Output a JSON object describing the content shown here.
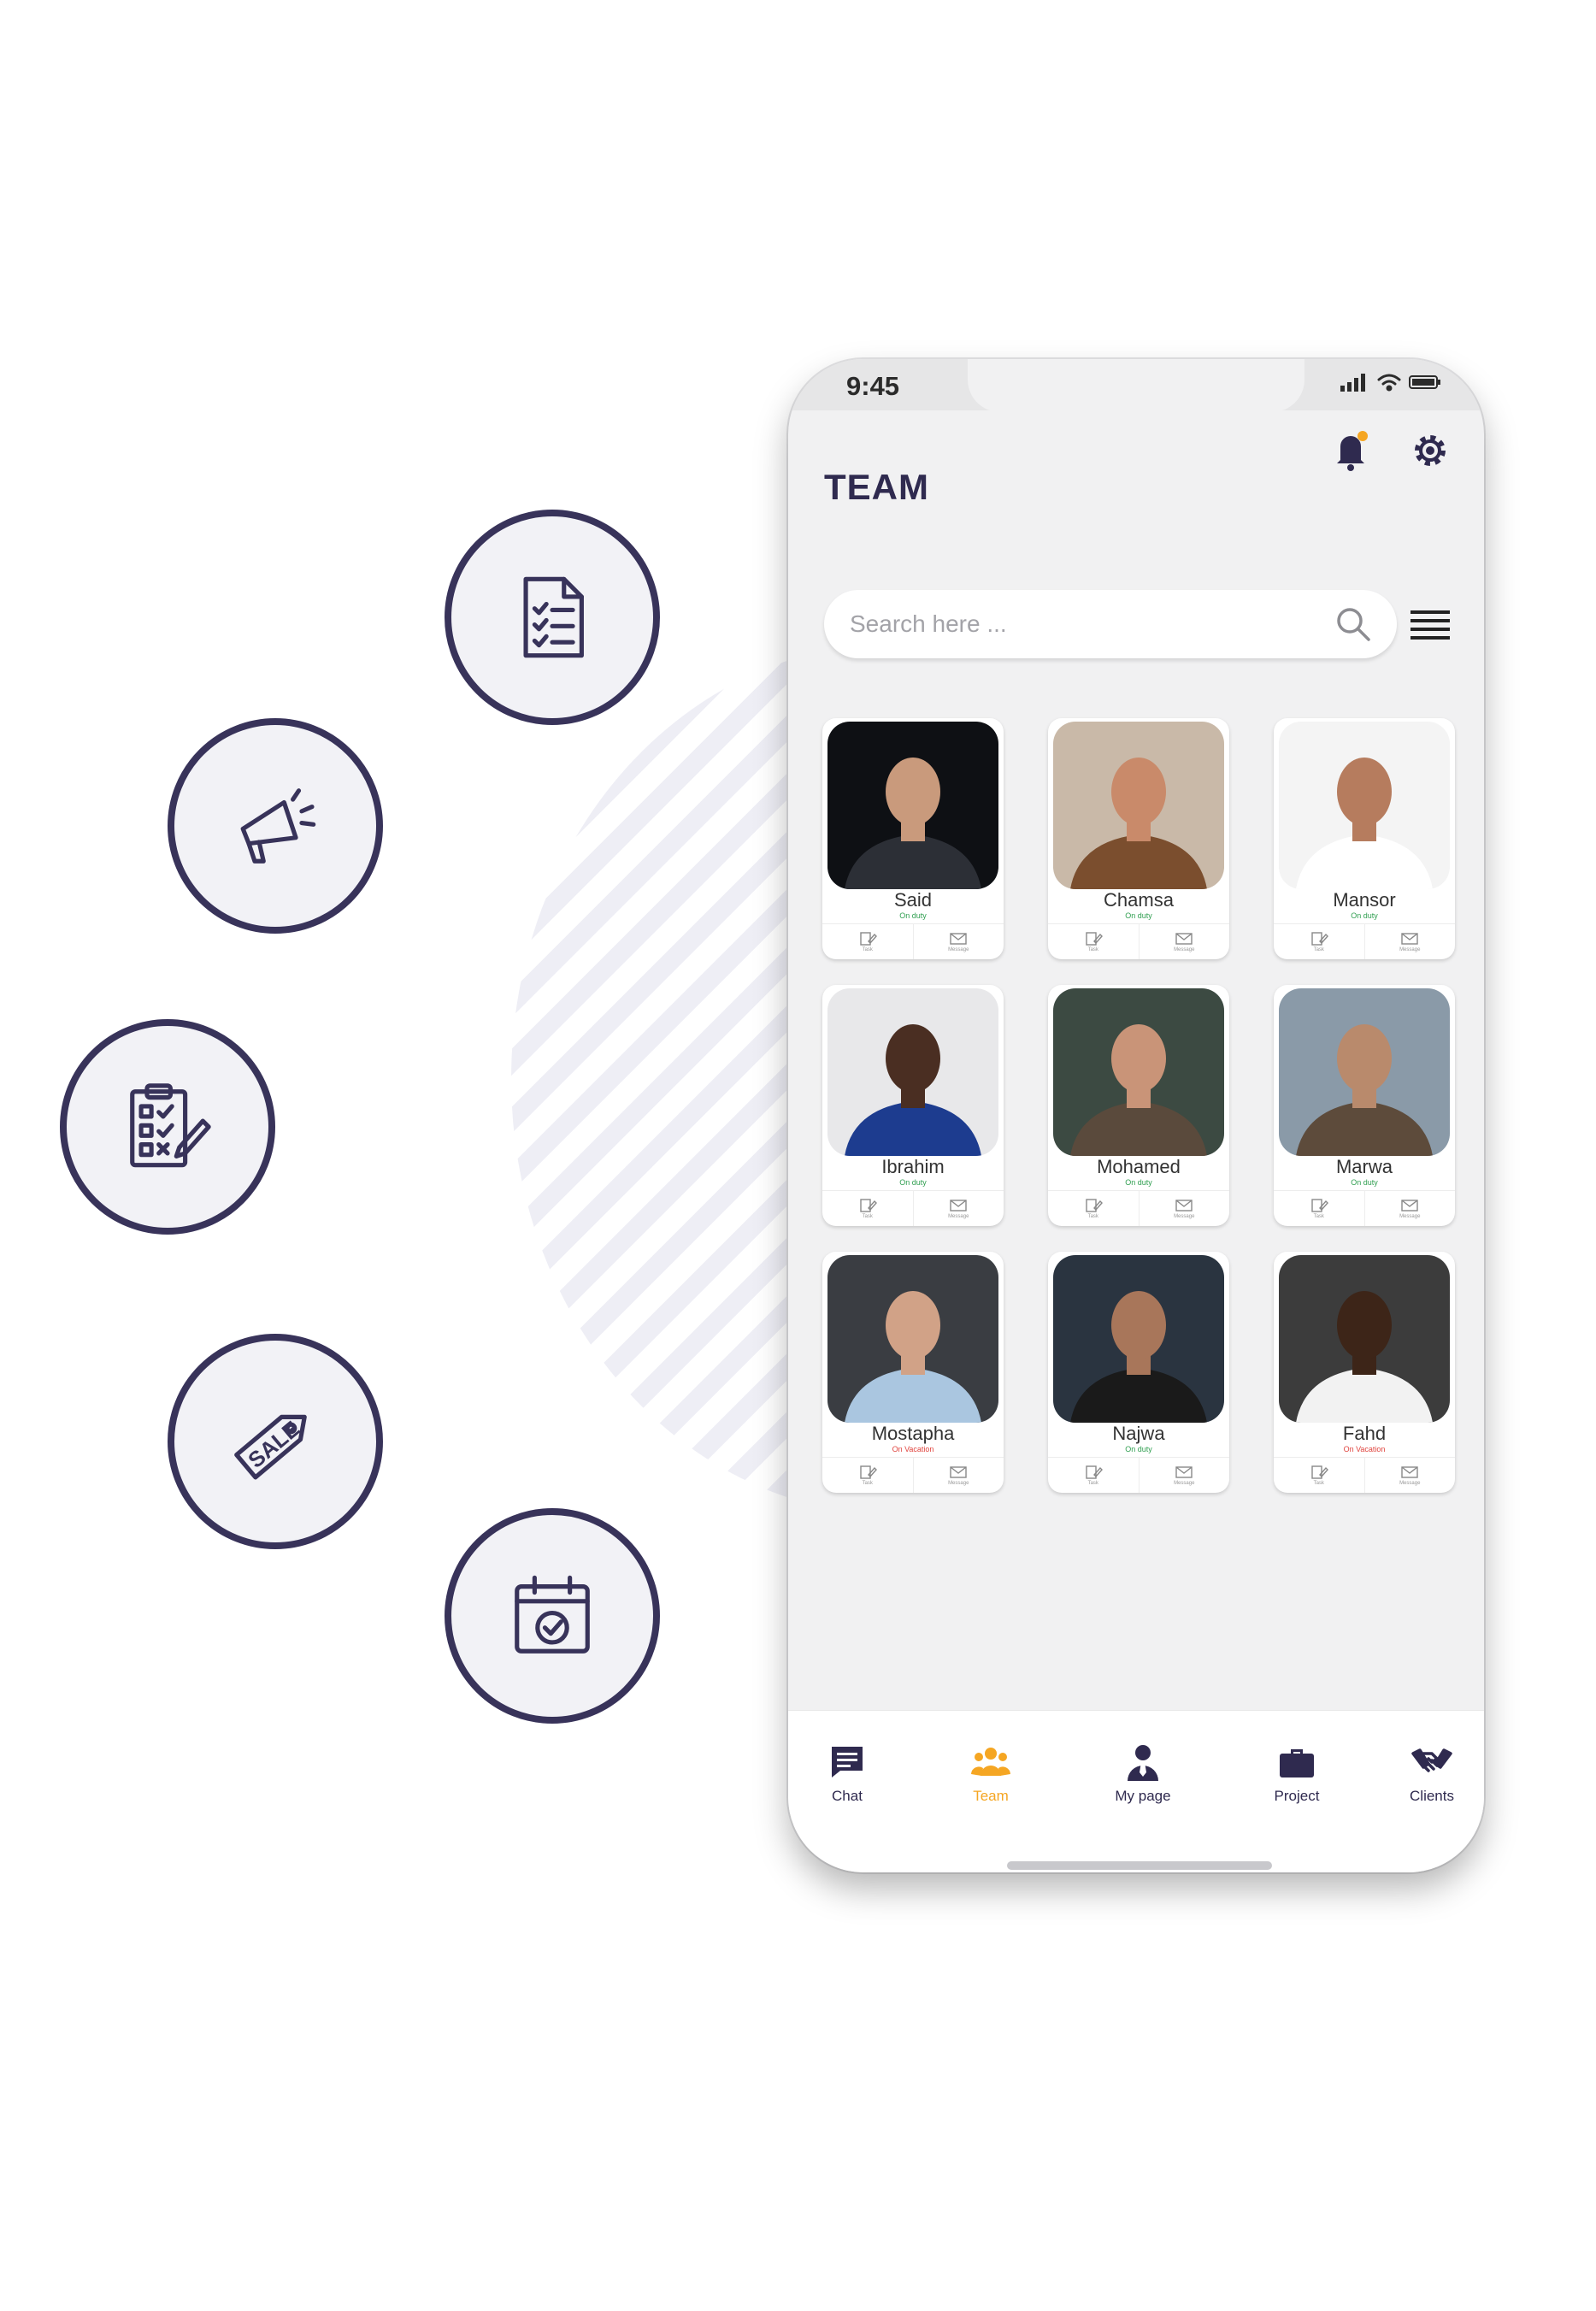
{
  "statusbar": {
    "time": "9:45"
  },
  "header": {
    "title": "TEAM"
  },
  "search": {
    "placeholder": "Search here ..."
  },
  "members": [
    {
      "name": "Said",
      "status": "On duty",
      "status_color": "#2e9e4f"
    },
    {
      "name": "Chamsa",
      "status": "On duty",
      "status_color": "#2e9e4f"
    },
    {
      "name": "Mansor",
      "status": "On duty",
      "status_color": "#2e9e4f"
    },
    {
      "name": "Ibrahim",
      "status": "On duty",
      "status_color": "#2e9e4f"
    },
    {
      "name": "Mohamed",
      "status": "On duty",
      "status_color": "#2e9e4f"
    },
    {
      "name": "Marwa",
      "status": "On duty",
      "status_color": "#2e9e4f"
    },
    {
      "name": "Mostapha",
      "status": "On Vacation",
      "status_color": "#e0443e"
    },
    {
      "name": "Najwa",
      "status": "On duty",
      "status_color": "#2e9e4f"
    },
    {
      "name": "Fahd",
      "status": "On Vacation",
      "status_color": "#e0443e"
    }
  ],
  "card_actions": {
    "task": "Task",
    "message": "Message"
  },
  "tabs": [
    {
      "label": "Chat",
      "icon": "chat-icon"
    },
    {
      "label": "Team",
      "icon": "team-icon",
      "active": true
    },
    {
      "label": "My page",
      "icon": "user-icon"
    },
    {
      "label": "Project",
      "icon": "briefcase-icon"
    },
    {
      "label": "Clients",
      "icon": "handshake-icon"
    }
  ],
  "features": [
    {
      "icon": "document-checklist-icon"
    },
    {
      "icon": "megaphone-icon"
    },
    {
      "icon": "clipboard-checklist-icon"
    },
    {
      "icon": "sale-tag-icon"
    },
    {
      "icon": "calendar-check-icon"
    }
  ],
  "colors": {
    "brand": "#2f2a4f",
    "accent": "#f5a623",
    "on_duty": "#2e9e4f",
    "on_vacation": "#e0443e"
  }
}
